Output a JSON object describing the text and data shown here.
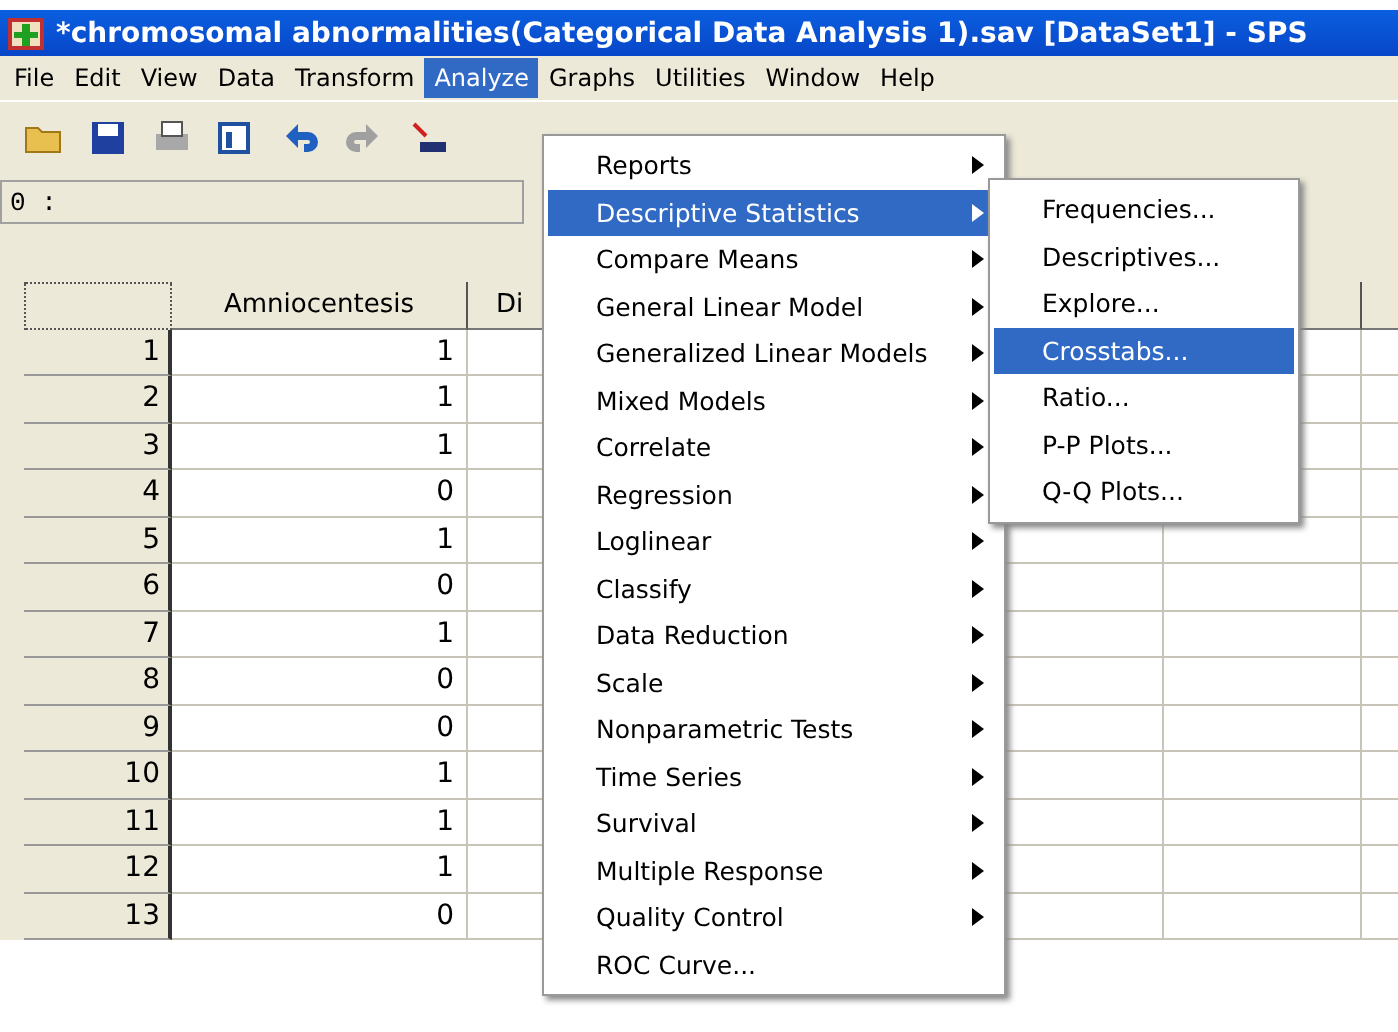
{
  "window": {
    "title": "*chromosomal abnormalities(Categorical Data Analysis 1).sav [DataSet1] - SPS"
  },
  "menubar": [
    {
      "label": "File",
      "selected": false
    },
    {
      "label": "Edit",
      "selected": false
    },
    {
      "label": "View",
      "selected": false
    },
    {
      "label": "Data",
      "selected": false
    },
    {
      "label": "Transform",
      "selected": false
    },
    {
      "label": "Analyze",
      "selected": true
    },
    {
      "label": "Graphs",
      "selected": false
    },
    {
      "label": "Utilities",
      "selected": false
    },
    {
      "label": "Window",
      "selected": false
    },
    {
      "label": "Help",
      "selected": false
    }
  ],
  "cell_editor": {
    "label": "0 :"
  },
  "grid": {
    "columns": [
      "Amniocentesis",
      "Di"
    ],
    "rows": [
      {
        "case": "1",
        "value": "1"
      },
      {
        "case": "2",
        "value": "1"
      },
      {
        "case": "3",
        "value": "1"
      },
      {
        "case": "4",
        "value": "0"
      },
      {
        "case": "5",
        "value": "1"
      },
      {
        "case": "6",
        "value": "0"
      },
      {
        "case": "7",
        "value": "1"
      },
      {
        "case": "8",
        "value": "0"
      },
      {
        "case": "9",
        "value": "0"
      },
      {
        "case": "10",
        "value": "1"
      },
      {
        "case": "11",
        "value": "1"
      },
      {
        "case": "12",
        "value": "1"
      },
      {
        "case": "13",
        "value": "0"
      }
    ]
  },
  "analyze_menu": [
    {
      "label": "Reports",
      "has_submenu": true,
      "selected": false
    },
    {
      "label": "Descriptive Statistics",
      "has_submenu": true,
      "selected": true
    },
    {
      "label": "Compare Means",
      "has_submenu": true,
      "selected": false
    },
    {
      "label": "General Linear Model",
      "has_submenu": true,
      "selected": false
    },
    {
      "label": "Generalized Linear Models",
      "has_submenu": true,
      "selected": false
    },
    {
      "label": "Mixed Models",
      "has_submenu": true,
      "selected": false
    },
    {
      "label": "Correlate",
      "has_submenu": true,
      "selected": false
    },
    {
      "label": "Regression",
      "has_submenu": true,
      "selected": false
    },
    {
      "label": "Loglinear",
      "has_submenu": true,
      "selected": false
    },
    {
      "label": "Classify",
      "has_submenu": true,
      "selected": false
    },
    {
      "label": "Data Reduction",
      "has_submenu": true,
      "selected": false
    },
    {
      "label": "Scale",
      "has_submenu": true,
      "selected": false
    },
    {
      "label": "Nonparametric Tests",
      "has_submenu": true,
      "selected": false
    },
    {
      "label": "Time Series",
      "has_submenu": true,
      "selected": false
    },
    {
      "label": "Survival",
      "has_submenu": true,
      "selected": false
    },
    {
      "label": "Multiple Response",
      "has_submenu": true,
      "selected": false
    },
    {
      "label": "Quality Control",
      "has_submenu": true,
      "selected": false
    },
    {
      "label": "ROC Curve...",
      "has_submenu": false,
      "selected": false
    }
  ],
  "descriptive_submenu": [
    {
      "label": "Frequencies...",
      "selected": false
    },
    {
      "label": "Descriptives...",
      "selected": false
    },
    {
      "label": "Explore...",
      "selected": false
    },
    {
      "label": "Crosstabs...",
      "selected": true
    },
    {
      "label": "Ratio...",
      "selected": false
    },
    {
      "label": "P-P Plots...",
      "selected": false
    },
    {
      "label": "Q-Q Plots...",
      "selected": false
    }
  ]
}
